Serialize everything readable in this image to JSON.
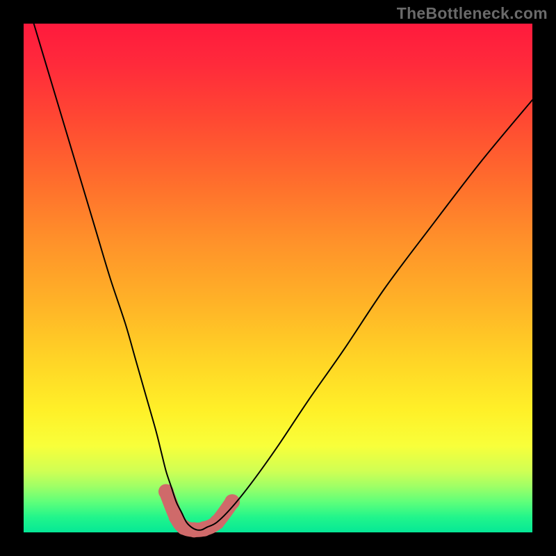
{
  "watermark": "TheBottleneck.com",
  "chart_data": {
    "type": "line",
    "title": "",
    "xlabel": "",
    "ylabel": "",
    "xlim": [
      0,
      100
    ],
    "ylim": [
      0,
      100
    ],
    "grid": false,
    "legend": false,
    "background_gradient": {
      "top_color": "#ff1a3d",
      "mid_color": "#ffe128",
      "bottom_color": "#05e896",
      "direction": "vertical"
    },
    "series": [
      {
        "name": "bottleneck-curve",
        "color": "#000000",
        "stroke_width": 2,
        "x": [
          2,
          5,
          8,
          11,
          14,
          17,
          20,
          22,
          24,
          26,
          27,
          28,
          29,
          30,
          31,
          32,
          33,
          34,
          35,
          36,
          38,
          41,
          45,
          50,
          56,
          63,
          71,
          80,
          90,
          100
        ],
        "values": [
          100,
          90,
          80,
          70,
          60,
          50,
          41,
          34,
          27,
          20,
          16,
          12,
          9,
          6,
          4,
          2,
          1,
          0.5,
          0.5,
          1,
          2,
          5,
          10,
          17,
          26,
          36,
          48,
          60,
          73,
          85
        ]
      },
      {
        "name": "minimum-markers",
        "type": "scatter",
        "color": "#cf6a6a",
        "marker_radius": 11,
        "x": [
          28,
          30,
          31.5,
          33.5,
          35.5,
          38,
          41
        ],
        "values": [
          8,
          3,
          1,
          0.5,
          0.7,
          2,
          6
        ]
      }
    ],
    "annotations": []
  }
}
